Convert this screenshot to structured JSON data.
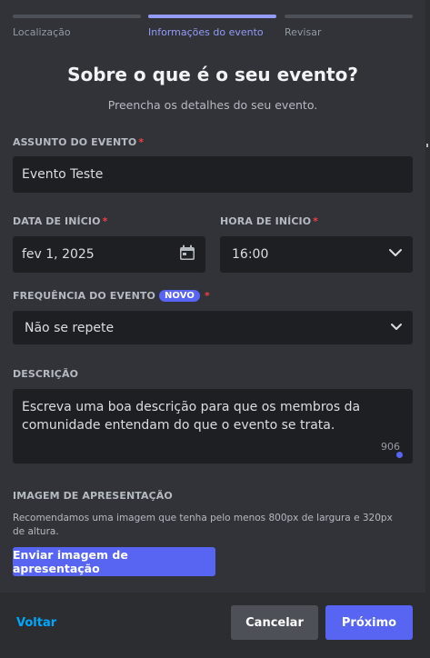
{
  "steps": [
    {
      "label": "Localização",
      "active": false
    },
    {
      "label": "Informações do evento",
      "active": true
    },
    {
      "label": "Revisar",
      "active": false
    }
  ],
  "header": {
    "title": "Sobre o que é o seu evento?",
    "subtitle": "Preencha os detalhes do seu evento."
  },
  "subject": {
    "label": "ASSUNTO DO EVENTO",
    "required_mark": "*",
    "value": "Evento Teste"
  },
  "start_date": {
    "label": "DATA DE INÍCIO",
    "required_mark": "*",
    "value": "fev 1, 2025",
    "icon": "calendar-icon"
  },
  "start_time": {
    "label": "HORA DE INÍCIO",
    "required_mark": "*",
    "value": "16:00",
    "icon": "chevron-down-icon"
  },
  "frequency": {
    "label": "FREQUÊNCIA DO EVENTO",
    "badge": "NOVO",
    "required_mark": "*",
    "value": "Não se repete",
    "icon": "chevron-down-icon"
  },
  "description": {
    "label": "DESCRIÇÃO",
    "placeholder": "Escreva uma boa descrição para que os membros da comunidade entendam do que o evento se trata.",
    "counter": "906"
  },
  "cover_image": {
    "label": "IMAGEM DE APRESENTAÇÃO",
    "hint": "Recomendamos uma imagem que tenha pelo menos 800px de largura e 320px de altura.",
    "button_label": "Enviar imagem de apresentação"
  },
  "footer": {
    "back_label": "Voltar",
    "cancel_label": "Cancelar",
    "next_label": "Próximo"
  },
  "colors": {
    "background": "#313338",
    "input_background": "#1e1f22",
    "accent": "#5865f2",
    "active_step": "#949cf7",
    "link": "#00a8fc",
    "required": "#f23f43"
  }
}
